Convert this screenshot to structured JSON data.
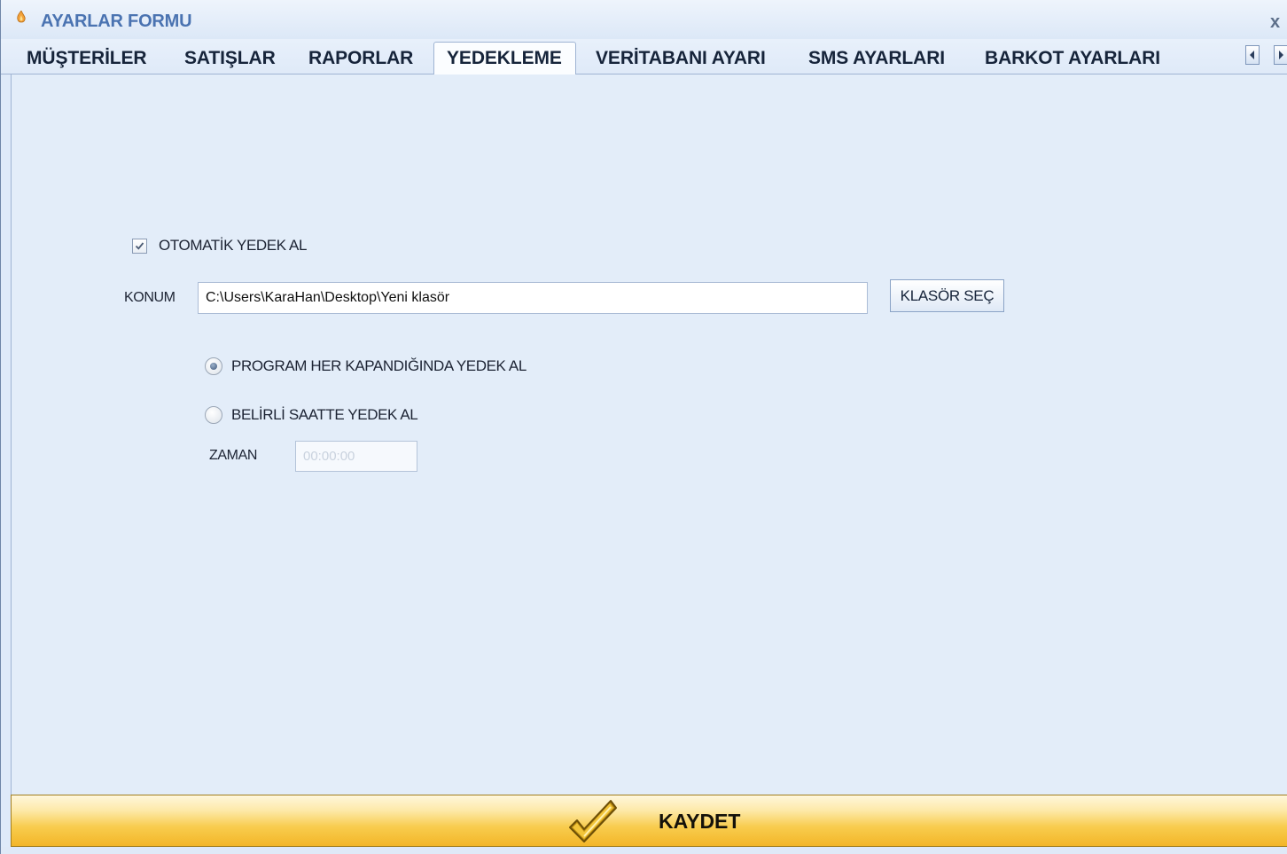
{
  "window": {
    "title": "AYARLAR FORMU",
    "close_label": "x"
  },
  "tabs": [
    {
      "label": "MÜŞTERİLER",
      "active": false
    },
    {
      "label": "SATIŞLAR",
      "active": false
    },
    {
      "label": "RAPORLAR",
      "active": false
    },
    {
      "label": "YEDEKLEME",
      "active": true
    },
    {
      "label": "VERİTABANI AYARI",
      "active": false
    },
    {
      "label": "SMS AYARLARI",
      "active": false
    },
    {
      "label": "BARKOT AYARLARI",
      "active": false
    }
  ],
  "backup": {
    "auto_backup_label": "OTOMATİK YEDEK AL",
    "auto_backup_checked": true,
    "location_label": "KONUM",
    "location_value": "C:\\Users\\KaraHan\\Desktop\\Yeni klasör",
    "choose_folder_label": "KLASÖR SEÇ",
    "option_on_close_label": "PROGRAM HER KAPANDIĞINDA YEDEK AL",
    "option_on_close_selected": true,
    "option_at_time_label": "BELİRLİ SAATTE YEDEK AL",
    "option_at_time_selected": false,
    "time_label": "ZAMAN",
    "time_value": "00:00:00"
  },
  "footer": {
    "save_label": "KAYDET"
  },
  "colors": {
    "title": "#4a73b1",
    "background": "#e3edf9",
    "save_bar": "#f8cc4e"
  }
}
